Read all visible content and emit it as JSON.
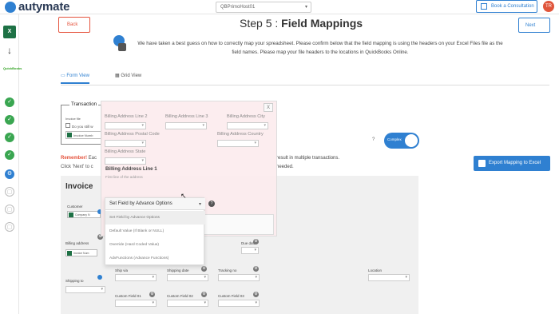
{
  "brand": {
    "name": "autymate",
    "accent": "#2f80d1",
    "danger": "#e5533d",
    "success": "#3aa651"
  },
  "header": {
    "company": "QBPrimoHost01",
    "consult_label": "Book a Consultation",
    "avatar_initials": "TR"
  },
  "sidebar": {
    "apps": [
      {
        "name": "excel-icon",
        "label": "X"
      },
      {
        "name": "arrow-down-icon",
        "label": "↓"
      },
      {
        "name": "quickbooks-icon",
        "label": "QuickBooks"
      }
    ],
    "steps": [
      {
        "state": "done",
        "glyph": "✓"
      },
      {
        "state": "done",
        "glyph": "✓"
      },
      {
        "state": "done",
        "glyph": "✓"
      },
      {
        "state": "done",
        "glyph": "✓"
      },
      {
        "state": "active",
        "glyph": "⚙"
      },
      {
        "state": "pending",
        "glyph": "▢"
      },
      {
        "state": "pending",
        "glyph": "▢"
      },
      {
        "state": "pending",
        "glyph": "▢"
      }
    ]
  },
  "nav": {
    "back": "Back",
    "next": "Next"
  },
  "page": {
    "title_prefix": "Step 5 : ",
    "title_bold": "Field Mappings",
    "intro": "We have taken a best guess on how to correctly map your spreadsheet. Please confirm below that the field mapping is using the headers on your Excel Files file as the field names. Please map your file headers to the locations in QuickBooks Online."
  },
  "tabs": {
    "form": "Form View",
    "grid": "Grid View"
  },
  "transaction": {
    "title": "Transaction",
    "file_label": "Invoice file",
    "checkbox_label": "Do you still w",
    "select_value": "Invoice Numb"
  },
  "notice": {
    "remember_label": "Remember!",
    "remember_text": " Eac",
    "line2": "Click 'Next' to c",
    "result_text": "result in multiple transactions.",
    "needed_text": "needed."
  },
  "toggle": {
    "label": "Complex",
    "on": true
  },
  "export_label": "Export Mapping to Excel",
  "invoice": {
    "title": "Invoice",
    "customer_label": "Customer",
    "customer_chip": "Company N",
    "billing_label": "Billing address",
    "billing_chip": "Invoice Num",
    "due_label": "Due date",
    "shipping_label": "Shipping to",
    "ship_via_label": "Ship via",
    "shipping_date_label": "Shipping date",
    "tracking_label": "Tracking no",
    "location_label": "Location",
    "custom1_label": "Custom Field 01",
    "custom2_label": "Custom Field 02",
    "custom3_label": "Custom Field 03"
  },
  "overlay": {
    "close": "X",
    "line2_label": "Billing Address Line 2",
    "line3_label": "Billing Address Line 3",
    "city_label": "Billing Address City",
    "postal_label": "Billing Address Postal Code",
    "country_label": "Billing Address Country",
    "state_label": "Billing Address State",
    "line1_heading": "Billing Address Line 1",
    "line1_sub": "First line of the address"
  },
  "dropdown": {
    "selected": "Set Field by Advance Options",
    "options": [
      "Set Field by Advance Options",
      "Default Value (If Blank or NULL)",
      "Override (Hard Coded Value)",
      "AdvFunctions (Advance Functions)"
    ]
  }
}
